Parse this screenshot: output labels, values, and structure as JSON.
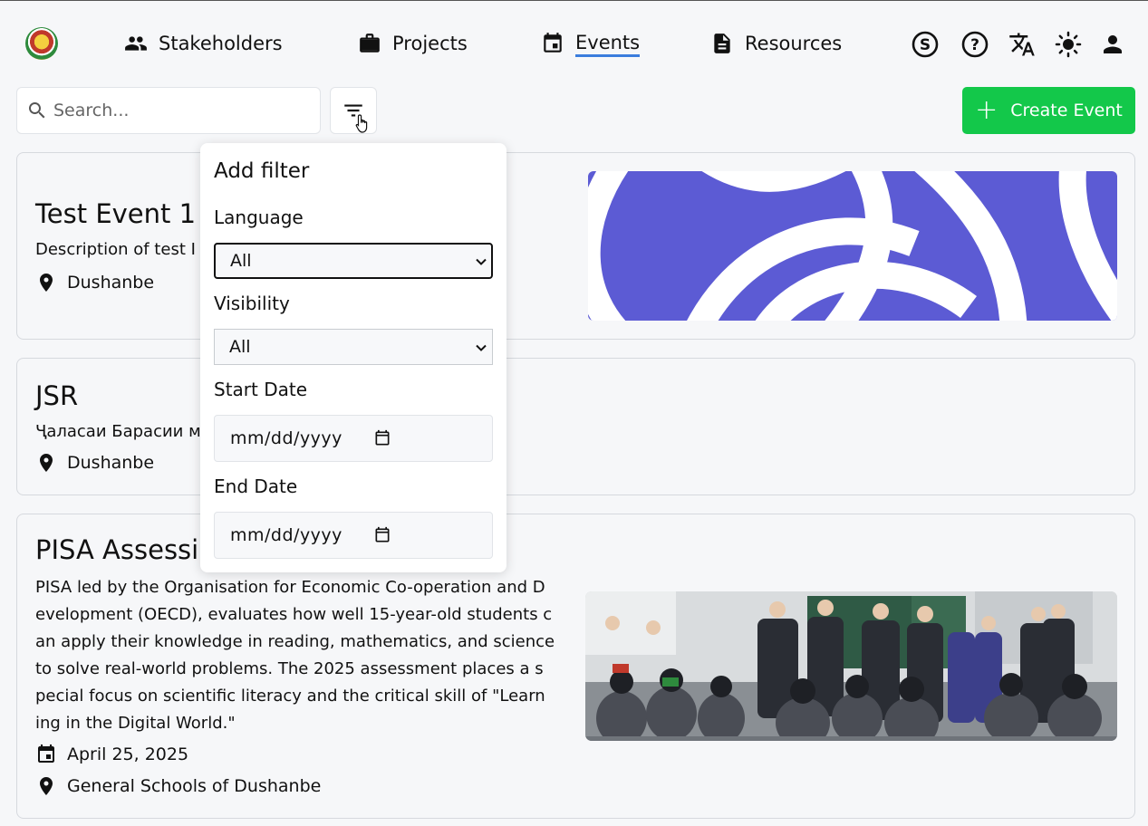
{
  "nav": {
    "items": [
      {
        "label": "Stakeholders",
        "icon": "people-icon"
      },
      {
        "label": "Projects",
        "icon": "briefcase-icon"
      },
      {
        "label": "Events",
        "icon": "calendar-icon",
        "active": true
      },
      {
        "label": "Resources",
        "icon": "document-icon"
      }
    ],
    "right_icons": [
      "currency-icon",
      "help-icon",
      "translate-icon",
      "theme-icon",
      "user-icon"
    ]
  },
  "toolbar": {
    "search_placeholder": "Search...",
    "create_label": "Create Event"
  },
  "filter_panel": {
    "title": "Add filter",
    "language_label": "Language",
    "language_value": "All",
    "visibility_label": "Visibility",
    "visibility_value": "All",
    "start_label": "Start Date",
    "start_value": "mm/dd/yyyy",
    "end_label": "End Date",
    "end_value": "mm/dd/yyyy"
  },
  "events": [
    {
      "title": "Test Event 1",
      "description": "Description of test I",
      "location": "Dushanbe"
    },
    {
      "title": "JSR",
      "description": "Ҷаласаи Барасии м",
      "location": "Dushanbe"
    },
    {
      "title": "PISA Assessi",
      "description_lines": [
        "PISA led by the Organisation for Economic Co-operation and D",
        "evelopment (OECD), evaluates how well 15-year-old students c",
        "an apply their knowledge in reading, mathematics, and science",
        "to solve real-world problems. The 2025 assessment places a s",
        "pecial focus on scientific literacy and the critical skill of \"Learn",
        "ing in the Digital World.\""
      ],
      "date": "April 25, 2025",
      "location": "General Schools of Dushanbe"
    }
  ],
  "colors": {
    "accent": "#3b7ddd",
    "create_button": "#13c84a",
    "banner": "#5c5bd4"
  }
}
